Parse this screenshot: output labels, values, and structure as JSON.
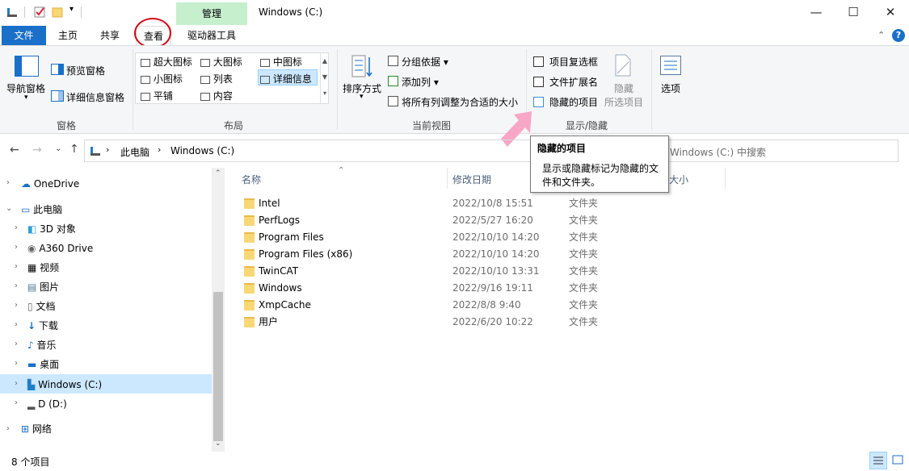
{
  "window": {
    "title": "Windows (C:)",
    "context_tab": "管理",
    "minimize": "—",
    "maximize": "☐",
    "close": "✕"
  },
  "tabs": {
    "file": "文件",
    "home": "主页",
    "share": "共享",
    "view": "查看",
    "drive_tools": "驱动器工具",
    "help": "?"
  },
  "ribbon": {
    "panes": {
      "nav_pane": "导航窗格",
      "preview_pane": "预览窗格",
      "details_pane": "详细信息窗格",
      "group": "窗格"
    },
    "layout": {
      "extra_large": "超大图标",
      "large": "大图标",
      "medium": "中图标",
      "small": "小图标",
      "list": "列表",
      "details": "详细信息",
      "tiles": "平铺",
      "content": "内容",
      "group": "布局"
    },
    "current_view": {
      "sort_by": "排序方式",
      "group_by": "分组依据",
      "add_columns": "添加列",
      "size_all_columns": "将所有列调整为合适的大小",
      "group": "当前视图"
    },
    "show_hide": {
      "item_checkboxes": "项目复选框",
      "file_extensions": "文件扩展名",
      "hidden_items": "隐藏的项目",
      "hide": "隐藏",
      "selected_items": "所选项目",
      "group": "显示/隐藏"
    },
    "options": "选项"
  },
  "address": {
    "breadcrumb_pc": "此电脑",
    "breadcrumb_drive": "Windows (C:)",
    "search_placeholder": "Windows (C:) 中搜索"
  },
  "tooltip": {
    "title": "隐藏的项目",
    "line1": "显示或隐藏标记为隐藏的文",
    "line2": "件和文件夹。"
  },
  "nav": {
    "onedrive": "OneDrive",
    "this_pc": "此电脑",
    "objects3d": "3D 对象",
    "a360": "A360 Drive",
    "videos": "视频",
    "pictures": "图片",
    "documents": "文档",
    "downloads": "下载",
    "music": "音乐",
    "desktop": "桌面",
    "drive_c": "Windows (C:)",
    "drive_d": "D (D:)",
    "network": "网络"
  },
  "columns": {
    "name": "名称",
    "date": "修改日期",
    "size": "大小"
  },
  "files": [
    {
      "name": "Intel",
      "date": "2022/10/8 15:51",
      "type": "文件夹"
    },
    {
      "name": "PerfLogs",
      "date": "2022/5/27 16:20",
      "type": "文件夹"
    },
    {
      "name": "Program Files",
      "date": "2022/10/10 14:20",
      "type": "文件夹"
    },
    {
      "name": "Program Files (x86)",
      "date": "2022/10/10 14:20",
      "type": "文件夹"
    },
    {
      "name": "TwinCAT",
      "date": "2022/10/10 13:31",
      "type": "文件夹"
    },
    {
      "name": "Windows",
      "date": "2022/9/16 19:11",
      "type": "文件夹"
    },
    {
      "name": "XmpCache",
      "date": "2022/8/8 9:40",
      "type": "文件夹"
    },
    {
      "name": "用户",
      "date": "2022/6/20 10:22",
      "type": "文件夹"
    }
  ],
  "status": {
    "count": "8 个项目"
  },
  "colors": {
    "accent": "#1a6fc9",
    "manage_tab": "#c6efce",
    "selection": "#cce8ff",
    "annotation_red": "#d10a16",
    "annotation_pink": "#f7a6c6"
  }
}
